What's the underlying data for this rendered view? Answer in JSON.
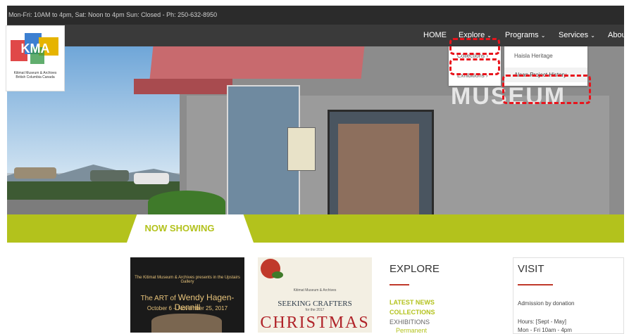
{
  "topbar": {
    "hours_text": "Mon-Fri: 10AM to 4pm, Sat: Noon to 4pm Sun: Closed - Ph: 250-632-8950"
  },
  "nav": {
    "home": "HOME",
    "explore": "Explore",
    "programs": "Programs",
    "services": "Services",
    "about": "Abou"
  },
  "explore_menu": [
    {
      "label": "Collections ›"
    },
    {
      "label": "Exhibitions ›"
    }
  ],
  "programs_menu": [
    {
      "label": "Haisla Heritage"
    },
    {
      "label": "Alcan Project History"
    }
  ],
  "logo": {
    "letters": "KMA",
    "caption_line1": "Kitimat Museum & Archives",
    "caption_line2": "British Columbia Canada"
  },
  "hero": {
    "sign": "MUSEUM"
  },
  "now_showing": {
    "label": "NOW SHOWING"
  },
  "cards": {
    "card1": {
      "intro": "The Kitimat Museum & Archives presents in the Upstairs Gallery",
      "title_prefix": "The ART of",
      "title_name": "Wendy Hagen-Dennill",
      "dates": "October 6 – November 25, 2017"
    },
    "card2": {
      "intro": "Kitimat Museum & Archives",
      "title": "SEEKING CRAFTERS",
      "sub": "for the 2017",
      "big": "CHRISTMAS"
    }
  },
  "explore": {
    "title": "EXPLORE",
    "links": [
      "LATEST NEWS",
      "COLLECTIONS",
      "EXHIBITIONS",
      "Permanent"
    ]
  },
  "visit": {
    "title": "VISIT",
    "admission": "Admission by donation",
    "hours": "Hours: [Sept - May]",
    "hours_line": "Mon - Fri  10am - 4pm"
  },
  "colors": {
    "accent_green": "#b3c21c",
    "accent_red": "#c0392b",
    "annotation_red": "#e8141c"
  }
}
